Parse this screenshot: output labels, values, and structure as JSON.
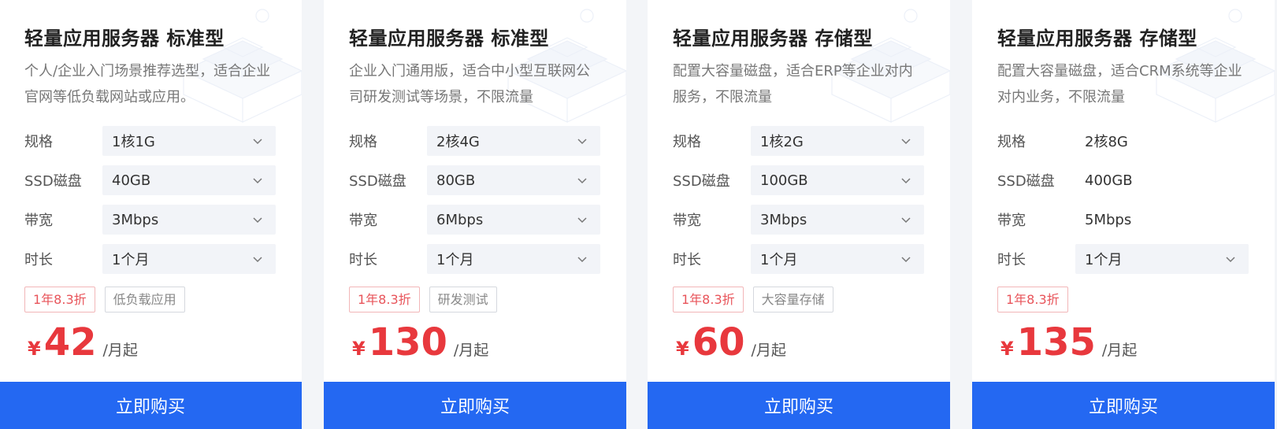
{
  "cards": [
    {
      "title": "轻量应用服务器 标准型",
      "desc": "个人/企业入门场景推荐选型，适合企业官网等低负载网站或应用。",
      "spec_label": "规格",
      "spec_value": "1核1G",
      "disk_label": "SSD磁盘",
      "disk_value": "40GB",
      "bw_label": "带宽",
      "bw_value": "3Mbps",
      "dur_label": "时长",
      "dur_value": "1个月",
      "tag_discount": "1年8.3折",
      "tag_use": "低负载应用",
      "currency": "¥",
      "price": "42",
      "unit": "/月起",
      "buy_label": "立即购买"
    },
    {
      "title": "轻量应用服务器 标准型",
      "desc": "企业入门通用版，适合中小型互联网公司研发测试等场景，不限流量",
      "spec_label": "规格",
      "spec_value": "2核4G",
      "disk_label": "SSD磁盘",
      "disk_value": "80GB",
      "bw_label": "带宽",
      "bw_value": "6Mbps",
      "dur_label": "时长",
      "dur_value": "1个月",
      "tag_discount": "1年8.3折",
      "tag_use": "研发测试",
      "currency": "¥",
      "price": "130",
      "unit": "/月起",
      "buy_label": "立即购买"
    },
    {
      "title": "轻量应用服务器 存储型",
      "desc": "配置大容量磁盘，适合ERP等企业对内服务，不限流量",
      "spec_label": "规格",
      "spec_value": "1核2G",
      "disk_label": "SSD磁盘",
      "disk_value": "100GB",
      "bw_label": "带宽",
      "bw_value": "3Mbps",
      "dur_label": "时长",
      "dur_value": "1个月",
      "tag_discount": "1年8.3折",
      "tag_use": "大容量存储",
      "currency": "¥",
      "price": "60",
      "unit": "/月起",
      "buy_label": "立即购买"
    },
    {
      "title": "轻量应用服务器 存储型",
      "desc": "配置大容量磁盘，适合CRM系统等企业对内业务，不限流量",
      "spec_label": "规格",
      "spec_value": "2核8G",
      "disk_label": "SSD磁盘",
      "disk_value": "400GB",
      "bw_label": "带宽",
      "bw_value": "5Mbps",
      "dur_label": "时长",
      "dur_value": "1个月",
      "tag_discount": "1年8.3折",
      "currency": "¥",
      "price": "135",
      "unit": "/月起",
      "buy_label": "立即购买"
    }
  ],
  "colors": {
    "accent": "#2468f2",
    "price": "#e8383d",
    "select_bg": "#f2f4f8"
  },
  "icons": {
    "dropdown": "chevron-down-icon"
  }
}
